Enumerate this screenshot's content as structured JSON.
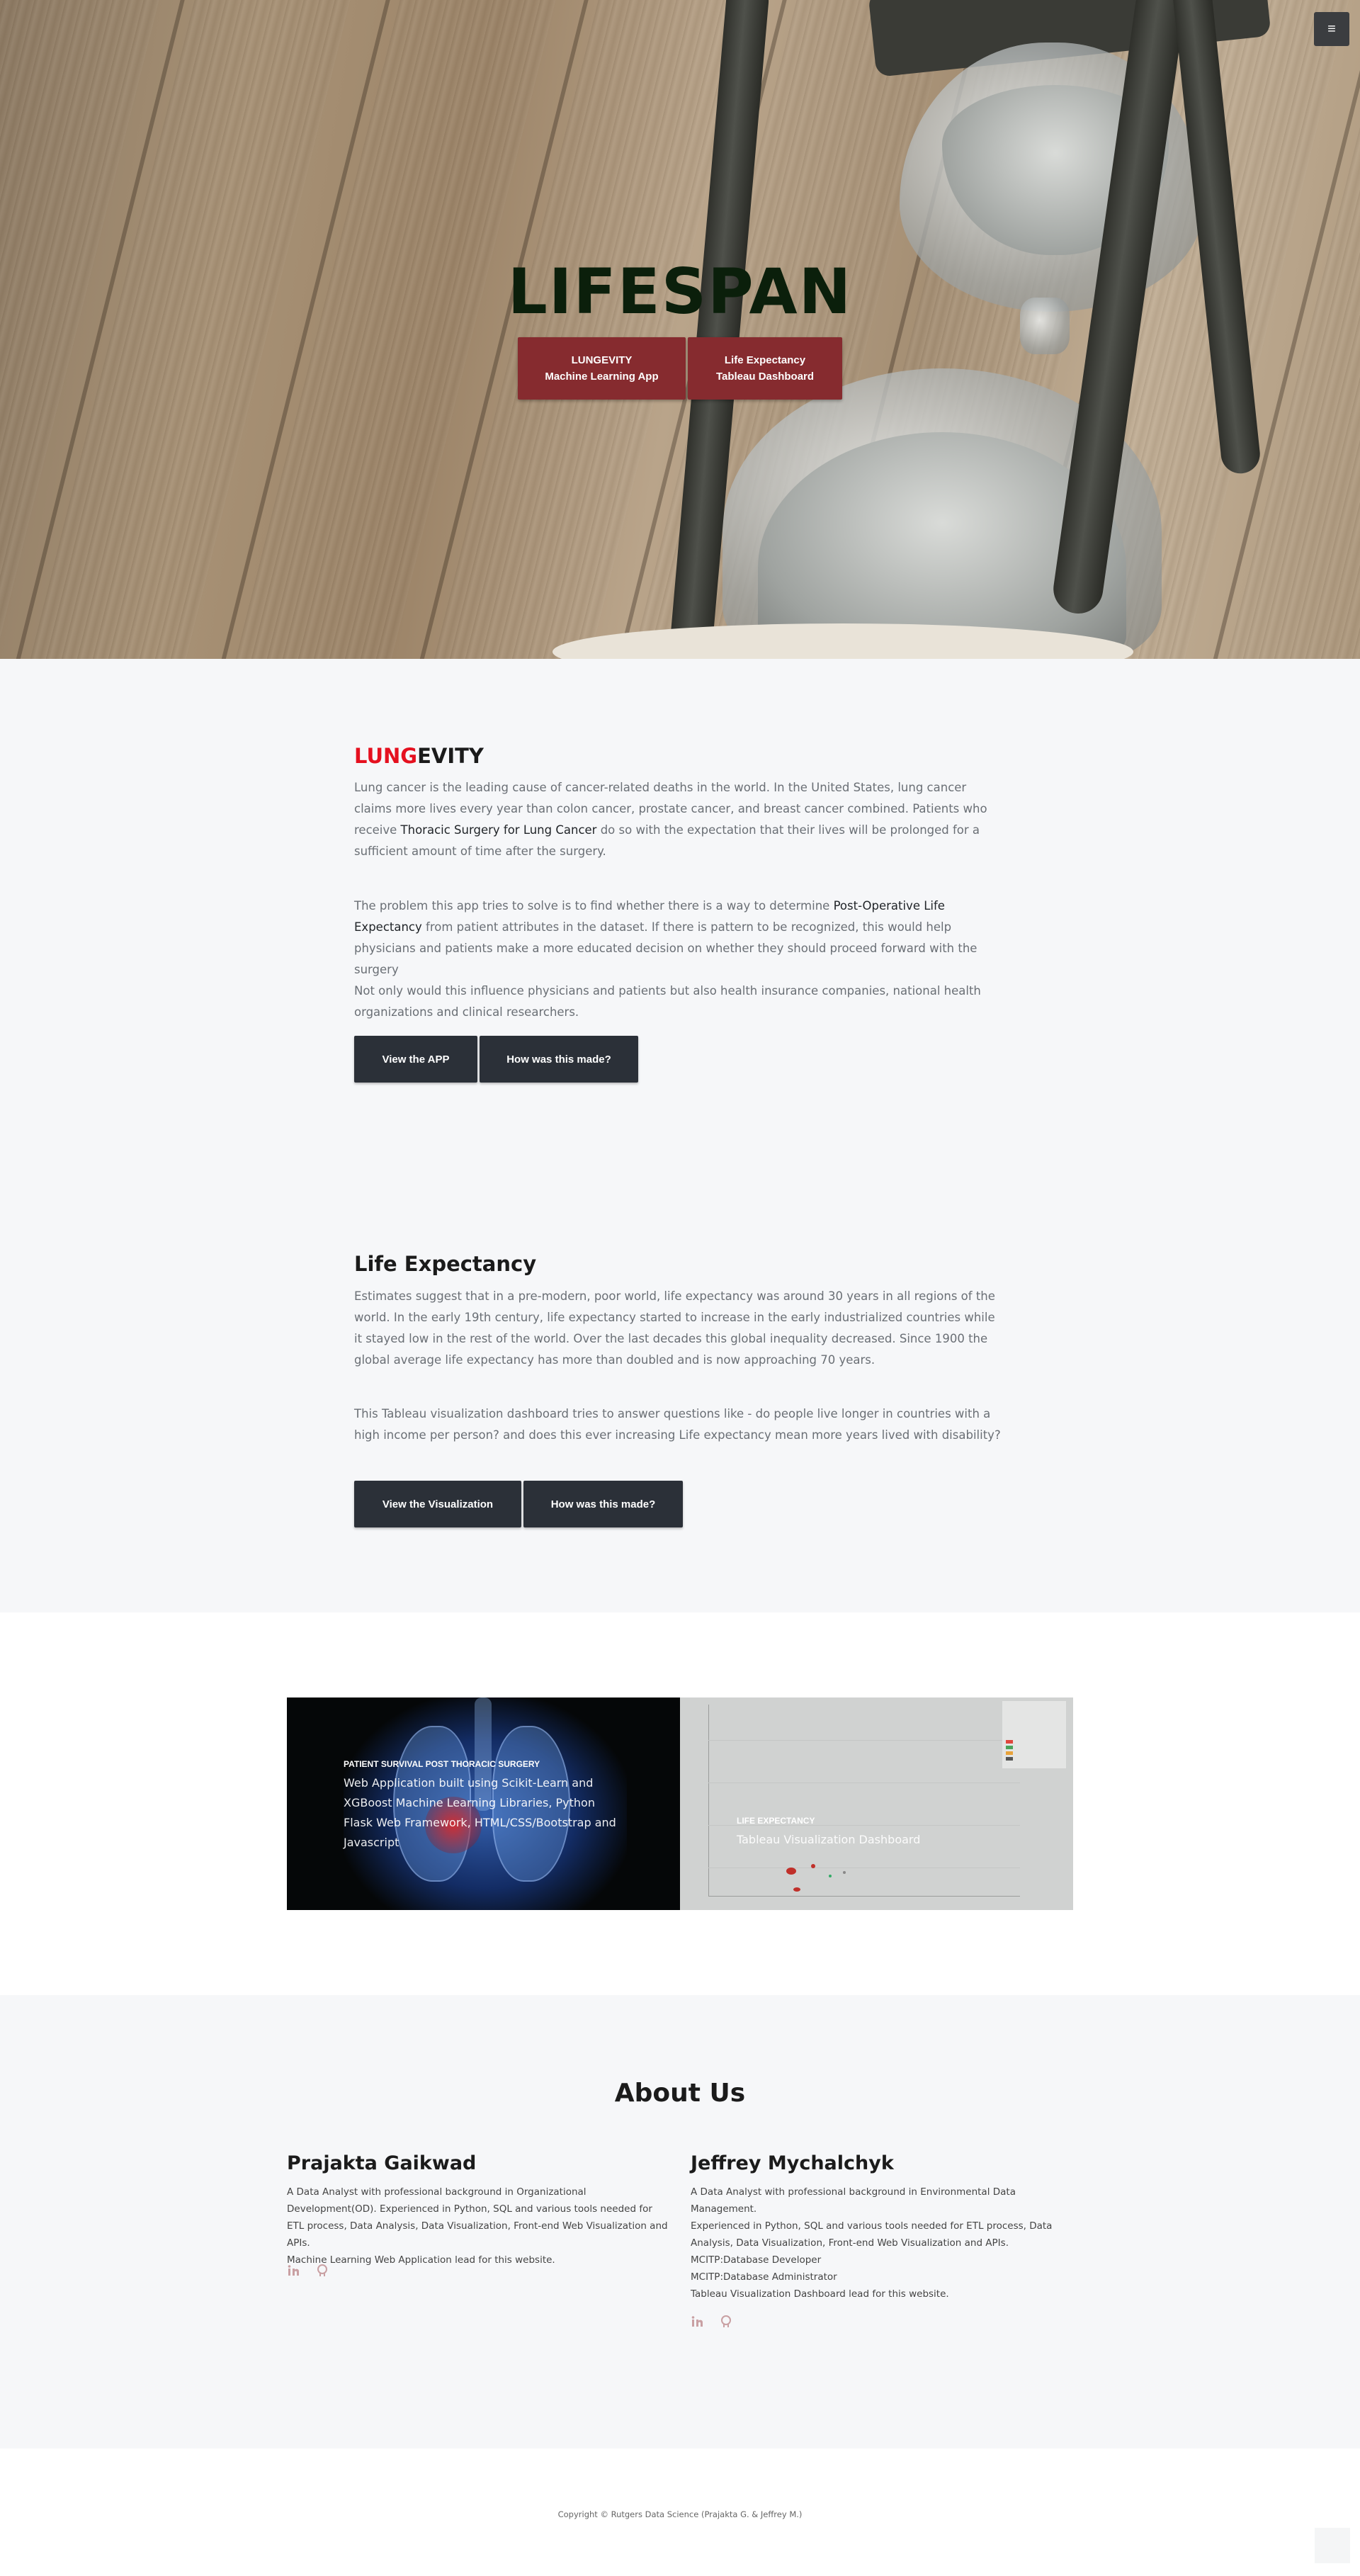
{
  "hero": {
    "title": "LIFESPAN",
    "buttons": [
      {
        "line1": "LUNGEVITY",
        "line2": "Machine Learning App"
      },
      {
        "line1": "Life Expectancy",
        "line2": "Tableau Dashboard"
      }
    ]
  },
  "menu": {
    "icon": "menu-icon",
    "glyph": "≡"
  },
  "lungevity": {
    "title_red": "LUNG",
    "title_rest": "EVITY",
    "p1_a": "Lung cancer is the leading cause of cancer-related deaths in the world. In the United States, lung cancer claims more lives every year than colon cancer, prostate cancer, and breast cancer combined. Patients who receive ",
    "p1_em": "Thoracic Surgery for Lung Cancer",
    "p1_b": " do so with the expectation that their lives will be prolonged for a sufficient amount of time after the surgery.",
    "p2_a": "The problem this app tries to solve is to find whether there is a way to determine ",
    "p2_em": "Post-Operative Life Expectancy",
    "p2_b": " from patient attributes in the dataset. If there is pattern to be recognized, this would help physicians and patients make a more educated decision on whether they should proceed forward with the surgery",
    "p2_c": "Not only would this influence physicians and patients but also health insurance companies, national health organizations and clinical researchers.",
    "btn_view": "View the APP",
    "btn_how": "How was this made?"
  },
  "life_expectancy": {
    "title": "Life Expectancy",
    "p1": "Estimates suggest that in a pre-modern, poor world, life expectancy was around 30 years in all regions of the world. In the early 19th century, life expectancy started to increase in the early industrialized countries while it stayed low in the rest of the world. Over the last decades this global inequality decreased. Since 1900 the global average life expectancy has more than doubled and is now approaching 70 years.",
    "p2": "This Tableau visualization dashboard tries to answer questions like - do people live longer in countries with a high income per person? and does this ever increasing Life expectancy mean more years lived with disability?",
    "btn_view": "View the Visualization",
    "btn_how": "How was this made?"
  },
  "portfolio": [
    {
      "category": "PATIENT SURVIVAL POST THORACIC SURGERY",
      "name": "Web Application built using Scikit-Learn and XGBoost Machine Learning Libraries, Python Flask Web Framework, HTML/CSS/Bootstrap and Javascript"
    },
    {
      "category": "LIFE EXPECTANCY",
      "name": "Tableau Visualization Dashboard"
    }
  ],
  "about": {
    "title": "About Us",
    "people": [
      {
        "name": "Prajakta Gaikwad",
        "bio": [
          "A Data Analyst with professional background in Organizational Development(OD). Experienced in Python, SQL and various tools needed for ETL process, Data Analysis, Data Visualization, Front-end Web Visualization and APIs.",
          "Machine Learning Web Application lead for this website."
        ],
        "icons": [
          "linkedin-icon",
          "github-icon"
        ]
      },
      {
        "name": "Jeffrey Mychalchyk",
        "bio": [
          "A Data Analyst with professional background in Environmental Data Management.",
          "Experienced in Python, SQL and various tools needed for ETL process, Data Analysis, Data Visualization, Front-end Web Visualization and APIs.",
          "MCITP:Database Developer",
          "MCITP:Database Administrator",
          "Tableau Visualization Dashboard lead for this website."
        ],
        "icons": [
          "linkedin-icon",
          "github-icon"
        ]
      }
    ]
  },
  "footer": {
    "copyright": "Copyright © Rutgers Data Science (Prajakta G. & Jeffrey M.)"
  },
  "colors": {
    "accent_red": "#862b2f",
    "title_red": "#e5101f",
    "dark_button": "#2b3038",
    "section_bg": "#f6f7f9"
  }
}
